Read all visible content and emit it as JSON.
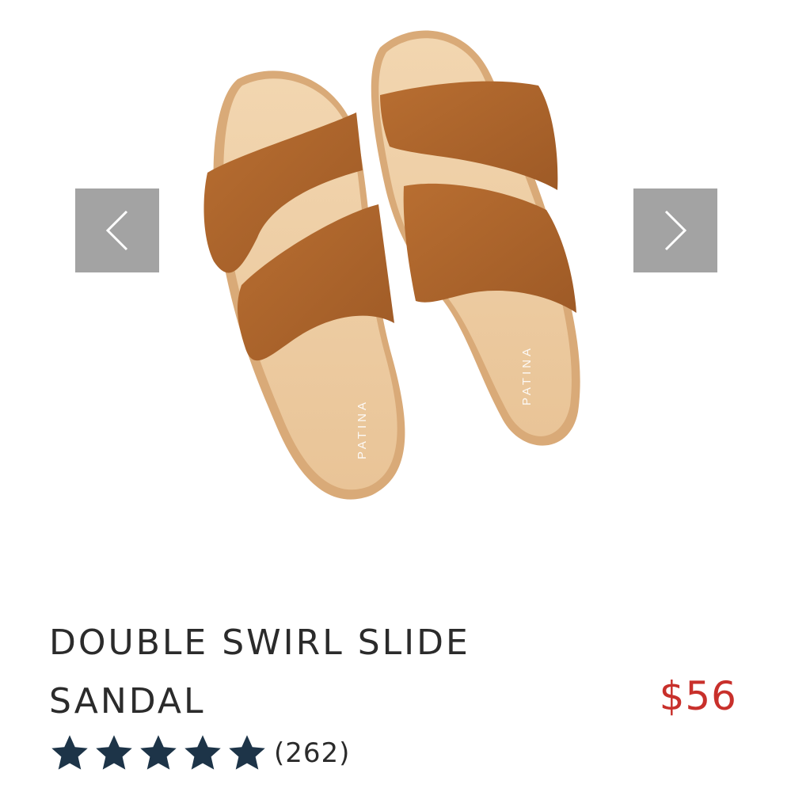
{
  "product": {
    "title_line1": "DOUBLE SWIRL SLIDE",
    "title_line2": "SANDAL",
    "price": "$56",
    "brand_imprint": "PATINA",
    "rating": {
      "stars": 5,
      "max": 5,
      "review_count": "(262)"
    },
    "image": {
      "subject": "pair of tan suede double-strap slide sandals"
    }
  },
  "gallery": {
    "prev_icon": "chevron-left-icon",
    "next_icon": "chevron-right-icon"
  },
  "colors": {
    "price": "#c8302b",
    "star": "#1d3448",
    "arrow_bg": "#a3a3a3",
    "strap": "#b0672e",
    "footbed": "#ebc79a",
    "title": "#2b2b2b"
  }
}
